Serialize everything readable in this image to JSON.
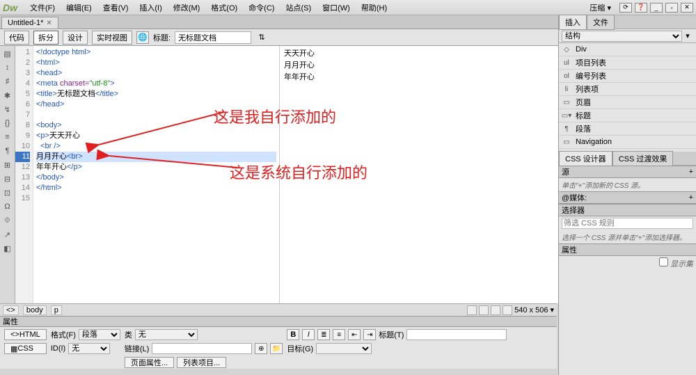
{
  "logo": "Dw",
  "menu": [
    "文件(F)",
    "编辑(E)",
    "查看(V)",
    "插入(I)",
    "修改(M)",
    "格式(O)",
    "命令(C)",
    "站点(S)",
    "窗口(W)",
    "帮助(H)"
  ],
  "menubar_right": {
    "compress": "压缩"
  },
  "doc_tab": {
    "name": "Untitled-1*"
  },
  "toolbar": {
    "code": "代码",
    "split": "拆分",
    "design": "设计",
    "live": "实时视图",
    "title_label": "标题:",
    "title_value": "无标题文档"
  },
  "code": {
    "lines": [
      {
        "n": 1,
        "html": "<span class='tag'>&lt;!doctype html&gt;</span>"
      },
      {
        "n": 2,
        "html": "<span class='tag'>&lt;html&gt;</span>"
      },
      {
        "n": 3,
        "html": "<span class='tag'>&lt;head&gt;</span>"
      },
      {
        "n": 4,
        "html": "<span class='tag'>&lt;meta</span> <span class='attr'>charset=</span><span class='val'>\"utf-8\"</span><span class='tag'>&gt;</span>"
      },
      {
        "n": 5,
        "html": "<span class='tag'>&lt;title&gt;</span><span class='txt'>无标题文档</span><span class='tag'>&lt;/title&gt;</span>"
      },
      {
        "n": 6,
        "html": "<span class='tag'>&lt;/head&gt;</span>"
      },
      {
        "n": 7,
        "html": ""
      },
      {
        "n": 8,
        "html": "<span class='tag'>&lt;body&gt;</span>"
      },
      {
        "n": 9,
        "html": "<span class='tag'>&lt;p&gt;</span><span class='txt'>天天开心</span>"
      },
      {
        "n": 10,
        "html": "  <span class='tag'>&lt;br /&gt;</span>"
      },
      {
        "n": 11,
        "html": "<span class='txt'>月月开心</span><span class='tag'>&lt;br&gt;</span>",
        "hl": true
      },
      {
        "n": 12,
        "html": "<span class='txt'>年年开心</span><span class='tag'>&lt;/p&gt;</span>"
      },
      {
        "n": 13,
        "html": "<span class='tag'>&lt;/body&gt;</span>"
      },
      {
        "n": 14,
        "html": "<span class='tag'>&lt;/html&gt;</span>"
      },
      {
        "n": 15,
        "html": ""
      }
    ]
  },
  "preview": [
    "天天开心",
    "月月开心",
    "年年开心"
  ],
  "annotations": {
    "top": "这是我自行添加的",
    "bottom": "这是系统自行添加的"
  },
  "right": {
    "tabs": [
      "插入",
      "文件"
    ],
    "structure_label": "结构",
    "items": [
      {
        "ico": "◇",
        "label": "Div"
      },
      {
        "ico": "ul",
        "label": "项目列表"
      },
      {
        "ico": "ol",
        "label": "编号列表"
      },
      {
        "ico": "li",
        "label": "列表项"
      },
      {
        "ico": "▭",
        "label": "页眉"
      },
      {
        "ico": "▭▾",
        "label": "标题"
      },
      {
        "ico": "¶",
        "label": "段落"
      },
      {
        "ico": "▭",
        "label": "Navigation"
      }
    ],
    "css_tabs": [
      "CSS 设计器",
      "CSS 过渡效果"
    ],
    "sources": {
      "title": "源",
      "add": "+",
      "body": "单击\"+\"添加新的 CSS 源。"
    },
    "media": {
      "title": "@媒体:",
      "add": "+"
    },
    "selectors": {
      "title": "选择器",
      "body_placeholder": "筛选 CSS 规则",
      "msg": "选择一个 CSS 源并单击\"+\"添加选择器。"
    },
    "props": {
      "title": "属性",
      "show_set": "显示集"
    }
  },
  "status": {
    "crumbs": [
      "body",
      "p"
    ],
    "size": "540 x 506"
  },
  "props_panel": {
    "title": "属性",
    "html_btn": "HTML",
    "css_btn": "CSS",
    "format_label": "格式(F)",
    "format_value": "段落",
    "id_label": "ID(I)",
    "id_value": "无",
    "class_label": "类",
    "class_value": "无",
    "link_label": "链接(L)",
    "title_label": "标题(T)",
    "target_label": "目标(G)",
    "page_props": "页面属性...",
    "list_props": "列表项目..."
  }
}
